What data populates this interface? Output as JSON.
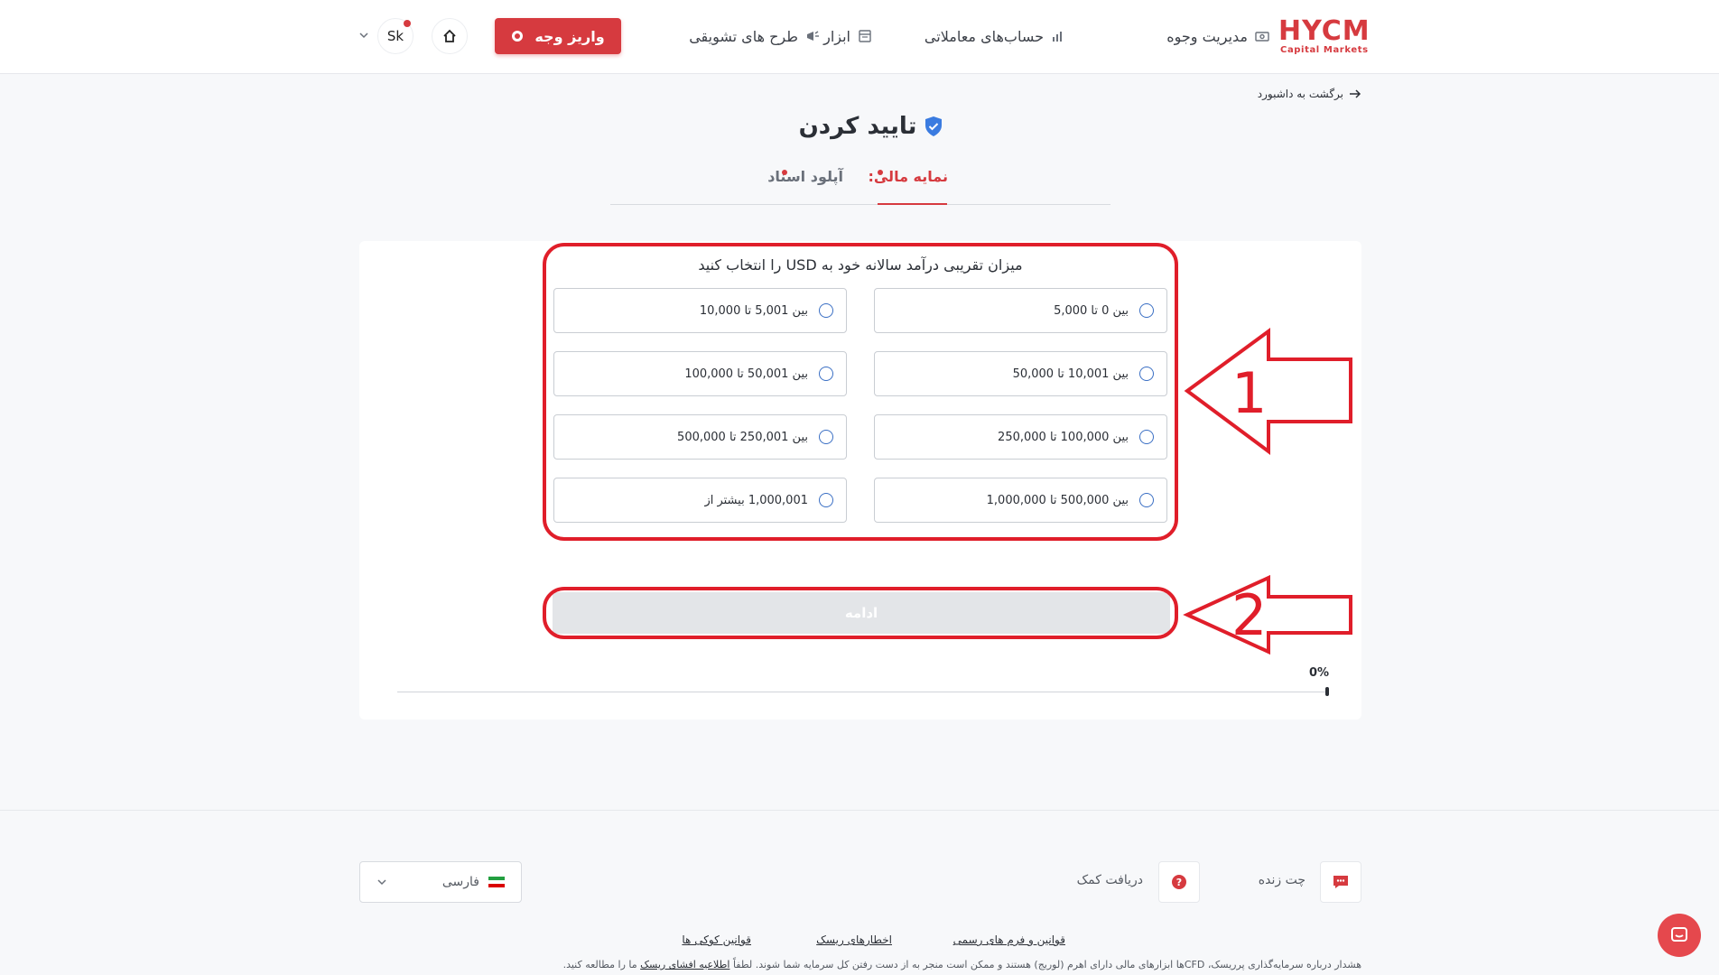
{
  "header": {
    "logo": "HYCM",
    "logo_sub": "Capital Markets",
    "nav": [
      {
        "label": "مدیریت وجوه",
        "icon": "cash-icon"
      },
      {
        "label": "حساب‌های معاملاتی",
        "icon": "chart-bars-icon"
      },
      {
        "label": "ابزار",
        "icon": "tools-icon"
      },
      {
        "label": "طرح های تشویقی",
        "icon": "megaphone-icon"
      }
    ],
    "deposit_label": "واریز وجه",
    "avatar_initials": "Sk"
  },
  "back_link": "برگشت به داشبورد",
  "page_title": "تایید کردن",
  "tabs": [
    {
      "label": "نمایه مالی:",
      "active": true
    },
    {
      "label": "آپلود اسناد",
      "active": false
    }
  ],
  "question": "میزان تقریبی درآمد سالانه خود به USD را انتخاب کنید",
  "options": [
    {
      "label": "بین 0 تا 5,000"
    },
    {
      "label": "بین 5,001 تا 10,000"
    },
    {
      "label": "بین 10,001 تا 50,000"
    },
    {
      "label": "بین 50,001 تا 100,000"
    },
    {
      "label": "بین 100,000 تا 250,000"
    },
    {
      "label": "بین 250,001 تا 500,000"
    },
    {
      "label": "بین 500,000 تا 1,000,000"
    },
    {
      "label": "1,000,001 بیشتر از"
    }
  ],
  "continue_label": "ادامه",
  "progress": {
    "label": "0%",
    "value": 0
  },
  "footer": {
    "live_chat": "چت زنده",
    "get_help": "دریافت کمک",
    "language": "فارسی",
    "links": [
      "قوانین و فرم های رسمی",
      "اخطارهای ریسک",
      "قوانین کوکی ها"
    ],
    "disclaimer_prefix": "هشدار درباره سرمایه‌گذاری پرریسک، CFDها ابزارهای مالی دارای اهرم (لوریج) هستند و ممکن است منجر به از دست رفتن کل سرمایه شما شوند. لطفاً",
    "disclaimer_link": "اطلاعیه افشای ریسک",
    "disclaimer_suffix": "ما را مطالعه کنید."
  },
  "annotations": {
    "marker_1": "1",
    "marker_2": "2"
  },
  "colors": {
    "brand": "#d63a3f",
    "annotation": "#e01e2a",
    "radio": "#3a6fc4"
  }
}
